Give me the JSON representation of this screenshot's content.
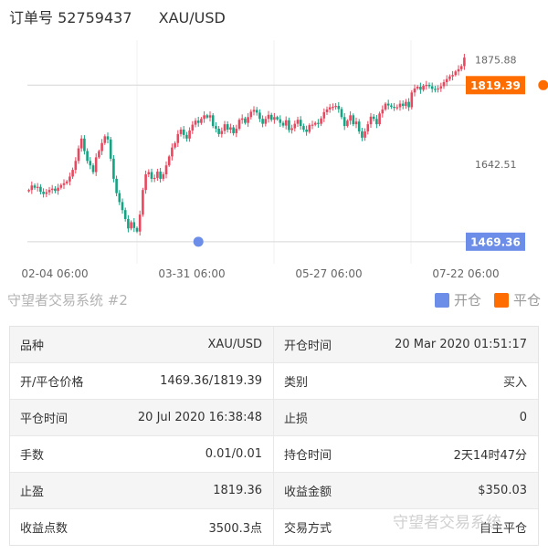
{
  "header": {
    "order_label": "订单号 52759437",
    "symbol": "XAU/USD"
  },
  "chart_data": {
    "type": "candlestick",
    "x_tick_labels": [
      "02-04 06:00",
      "03-31 06:00",
      "05-27 06:00",
      "07-22 06:00"
    ],
    "y_tick_labels": [
      "1875.88",
      "1642.51"
    ],
    "ylim": [
      1420,
      1920
    ],
    "price_tags": [
      {
        "label": "1819.39",
        "value": 1819.39,
        "color": "#ff6d00"
      },
      {
        "label": "1469.36",
        "value": 1469.36,
        "color": "#6c8ee8"
      }
    ],
    "open_point": {
      "index": 58,
      "value": 1469.36,
      "color": "#6c8ee8"
    },
    "close_point": {
      "index": 176,
      "value": 1819.39,
      "color": "#ff6d00"
    },
    "up_color": "#e8485f",
    "down_color": "#15a383",
    "closes": [
      1585,
      1595,
      1590,
      1592,
      1581,
      1576,
      1580,
      1585,
      1588,
      1583,
      1590,
      1596,
      1600,
      1604,
      1615,
      1630,
      1650,
      1678,
      1700,
      1672,
      1650,
      1640,
      1625,
      1658,
      1672,
      1690,
      1705,
      1698,
      1655,
      1610,
      1578,
      1558,
      1540,
      1520,
      1499,
      1513,
      1500,
      1492,
      1530,
      1585,
      1620,
      1625,
      1610,
      1612,
      1626,
      1610,
      1620,
      1640,
      1660,
      1680,
      1690,
      1710,
      1720,
      1708,
      1700,
      1718,
      1731,
      1740,
      1735,
      1744,
      1752,
      1747,
      1752,
      1728,
      1722,
      1710,
      1717,
      1732,
      1720,
      1725,
      1712,
      1722,
      1742,
      1745,
      1735,
      1748,
      1760,
      1764,
      1758,
      1744,
      1733,
      1744,
      1753,
      1742,
      1748,
      1743,
      1735,
      1729,
      1741,
      1719,
      1723,
      1733,
      1742,
      1728,
      1720,
      1715,
      1730,
      1731,
      1735,
      1733,
      1745,
      1759,
      1765,
      1770,
      1771,
      1773,
      1766,
      1748,
      1728,
      1740,
      1752,
      1732,
      1738,
      1716,
      1702,
      1716,
      1732,
      1749,
      1744,
      1732,
      1756,
      1765,
      1778,
      1774,
      1771,
      1770,
      1770,
      1778,
      1773,
      1782,
      1770,
      1803,
      1812,
      1816,
      1809,
      1818,
      1820,
      1817,
      1811,
      1810,
      1812,
      1817,
      1826,
      1833,
      1839,
      1842,
      1850,
      1855,
      1862,
      1881
    ]
  },
  "legend": {
    "title": "守望者交易系统 #2",
    "items": [
      {
        "label": "开仓",
        "color": "#6c8ee8"
      },
      {
        "label": "平仓",
        "color": "#ff6d00"
      }
    ]
  },
  "table": [
    {
      "k1": "品种",
      "v1": "XAU/USD",
      "k2": "开仓时间",
      "v2": "20 Mar 2020 01:51:17"
    },
    {
      "k1": "开/平仓价格",
      "v1": "1469.36/1819.39",
      "k2": "类别",
      "v2": "买入"
    },
    {
      "k1": "平仓时间",
      "v1": "20 Jul 2020 16:38:48",
      "k2": "止损",
      "v2": "0"
    },
    {
      "k1": "手数",
      "v1": "0.01/0.01",
      "k2": "持仓时间",
      "v2": "2天14时47分"
    },
    {
      "k1": "止盈",
      "v1": "1819.36",
      "k2": "收益金额",
      "v2": "$350.03"
    },
    {
      "k1": "收益点数",
      "v1": "3500.3点",
      "k2": "交易方式",
      "v2": "自主平仓"
    }
  ],
  "watermark": "守望者交易系统"
}
